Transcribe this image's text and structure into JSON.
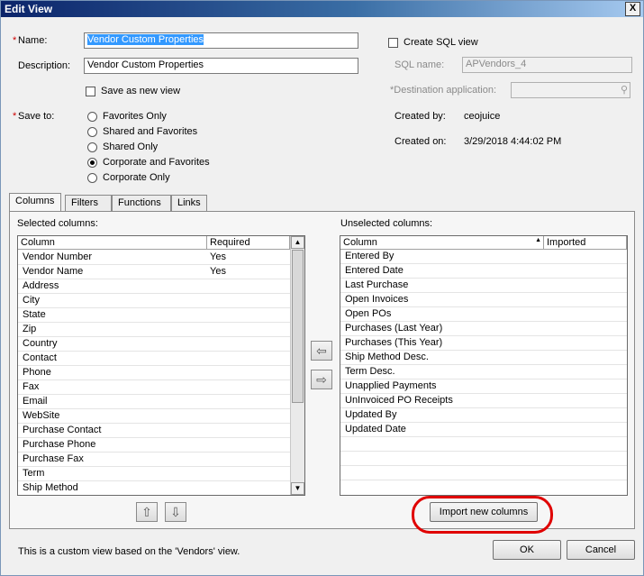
{
  "window": {
    "title": "Edit View",
    "close_glyph": "X"
  },
  "form": {
    "name_req": "*",
    "name_label": "Name:",
    "name_value": "Vendor Custom Properties",
    "description_label": "Description:",
    "description_value": "Vendor Custom Properties",
    "save_new_label": "Save as new view",
    "save_to_req": "*",
    "save_to_label": "Save to:",
    "save_options": [
      "Favorites Only",
      "Shared and Favorites",
      "Shared Only",
      "Corporate and Favorites",
      "Corporate Only"
    ],
    "save_selected": "Corporate and Favorites",
    "create_sql_label": "Create SQL view",
    "sql_name_label": "SQL name:",
    "sql_name_value": "APVendors_4",
    "dest_app_label": "*Destination application:",
    "created_by_label": "Created by:",
    "created_by_value": "ceojuice",
    "created_on_label": "Created on:",
    "created_on_value": "3/29/2018 4:44:02 PM"
  },
  "tabs": [
    "Columns",
    "Filters",
    "Functions",
    "Links"
  ],
  "selected": {
    "label": "Selected columns:",
    "headers": [
      "Column",
      "Required"
    ],
    "rows": [
      [
        "Vendor Number",
        "Yes"
      ],
      [
        "Vendor Name",
        "Yes"
      ],
      [
        "Address",
        ""
      ],
      [
        "City",
        ""
      ],
      [
        "State",
        ""
      ],
      [
        "Zip",
        ""
      ],
      [
        "Country",
        ""
      ],
      [
        "Contact",
        ""
      ],
      [
        "Phone",
        ""
      ],
      [
        "Fax",
        ""
      ],
      [
        "Email",
        ""
      ],
      [
        "WebSite",
        ""
      ],
      [
        "Purchase Contact",
        ""
      ],
      [
        "Purchase Phone",
        ""
      ],
      [
        "Purchase Fax",
        ""
      ],
      [
        "Term",
        ""
      ],
      [
        "Ship Method",
        ""
      ]
    ]
  },
  "unselected": {
    "label": "Unselected columns:",
    "headers": [
      "Column",
      "Imported"
    ],
    "rows": [
      "Entered By",
      "Entered Date",
      "Last Purchase",
      "Open Invoices",
      "Open POs",
      "Purchases (Last Year)",
      "Purchases (This Year)",
      "Ship Method Desc.",
      "Term Desc.",
      "Unapplied Payments",
      "UnInvoiced PO Receipts",
      "Updated By",
      "Updated Date"
    ]
  },
  "buttons": {
    "import": "Import new columns",
    "ok": "OK",
    "cancel": "Cancel",
    "move_left_glyph": "⇦",
    "move_right_glyph": "⇨",
    "move_up_glyph": "⇧",
    "move_down_glyph": "⇩",
    "scroll_up_glyph": "▲",
    "scroll_down_glyph": "▼",
    "sort_glyph": "▲"
  },
  "status": "This is a custom view based on the 'Vendors' view.",
  "colors": {
    "title_bar": "#0b246a",
    "highlight": "#3399ff",
    "annotation": "#e00000"
  }
}
